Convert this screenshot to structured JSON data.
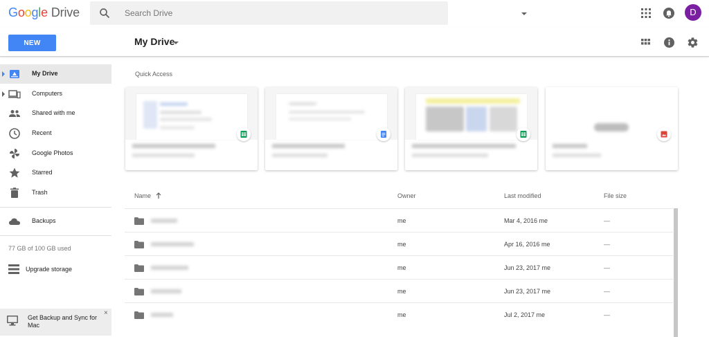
{
  "app": {
    "logo": {
      "g1": "G",
      "g2": "o",
      "g3": "o",
      "g4": "g",
      "g5": "l",
      "g6": "e",
      "product": "Drive"
    },
    "search": {
      "placeholder": "Search Drive",
      "value": ""
    },
    "avatar_letter": "D"
  },
  "toolbar": {
    "new_label": "NEW",
    "title": "My Drive"
  },
  "sidebar": {
    "items": [
      {
        "label": "My Drive",
        "icon": "my-drive-icon",
        "active": true
      },
      {
        "label": "Computers",
        "icon": "computers-icon"
      },
      {
        "label": "Shared with me",
        "icon": "shared-people-icon"
      },
      {
        "label": "Recent",
        "icon": "clock-icon"
      },
      {
        "label": "Google Photos",
        "icon": "pinwheel-icon"
      },
      {
        "label": "Starred",
        "icon": "star-icon"
      },
      {
        "label": "Trash",
        "icon": "trash-icon"
      }
    ],
    "backups_label": "Backups",
    "storage_text": "77 GB of 100 GB used",
    "upgrade_label": "Upgrade storage",
    "promo": {
      "text": "Get Backup and Sync for Mac",
      "close": "×"
    }
  },
  "quick_access": {
    "label": "Quick Access",
    "cards": [
      {
        "type": "sheets-icon",
        "badge_color": "#0f9d58"
      },
      {
        "type": "docs-icon",
        "badge_color": "#4285f4"
      },
      {
        "type": "sheets-icon",
        "badge_color": "#0f9d58"
      },
      {
        "type": "image-icon",
        "badge_color": "#db4437"
      }
    ]
  },
  "file_list": {
    "columns": {
      "name": "Name",
      "owner": "Owner",
      "modified": "Last modified",
      "size": "File size"
    },
    "rows": [
      {
        "owner": "me",
        "modified": "Mar 4, 2016  me",
        "size": "—"
      },
      {
        "owner": "me",
        "modified": "Apr 16, 2016  me",
        "size": "—"
      },
      {
        "owner": "me",
        "modified": "Jun 23, 2017  me",
        "size": "—"
      },
      {
        "owner": "me",
        "modified": "Jun 23, 2017  me",
        "size": "—"
      },
      {
        "owner": "me",
        "modified": "Jul 2, 2017  me",
        "size": "—"
      }
    ]
  },
  "colors": {
    "accent": "#4285f4",
    "avatar": "#7b1fa2",
    "sheets": "#0f9d58",
    "docs": "#4285f4",
    "image": "#db4437"
  }
}
